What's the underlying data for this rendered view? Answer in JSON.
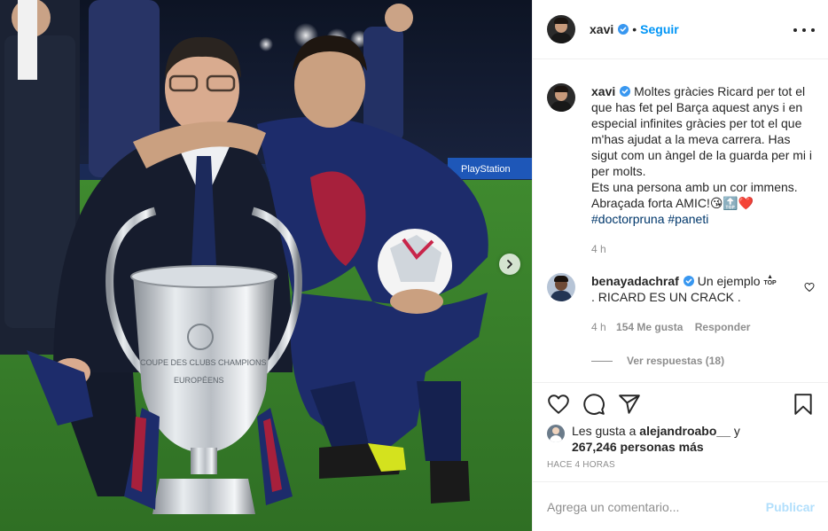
{
  "post": {
    "username": "xavi",
    "follow_label": "Seguir",
    "header_separator": "•",
    "caption": {
      "username": "xavi",
      "text": "Moltes gràcies Ricard per tot el que has fet pel Barça aquest anys i en especial infinites gràcies per tot el que m'has ajudat a la meva carrera. Has sigut com un àngel de la guarda per mi i per molts.\nEts una persona amb un cor immens. Abraçada forta AMIC!😘🔝❤️",
      "tags": "#doctorpruna #paneti",
      "time": "4 h"
    },
    "comments": [
      {
        "username": "benayadachraf",
        "text_before": "Un ejemplo",
        "badge": "TOP",
        "text_after": ". RICARD ES UN CRACK .",
        "time": "4 h",
        "likes": "154 Me gusta",
        "reply_label": "Responder"
      }
    ],
    "view_replies": "Ver respuestas (18)",
    "likes": {
      "prefix": "Les gusta a",
      "liker": "alejandroabo__",
      "connector": "y",
      "others": "267,246 personas más"
    },
    "time_ago": "HACE 4 HORAS",
    "add_comment_placeholder": "Agrega un comentario...",
    "publish_label": "Publicar"
  },
  "photo": {
    "trophy_text_top": "COUPE DES CLUBS CHAMPIONS",
    "trophy_text_bottom": "EUROPÉENS",
    "banner_text": "PlayStation"
  },
  "colors": {
    "accent": "#0095f6",
    "publish_disabled": "#b2dffc",
    "muted": "#8e8e8e",
    "barca_blue": "#1d2c6b",
    "barca_red": "#a7203c"
  },
  "icons": [
    "verified-icon",
    "more-options-icon",
    "heart-icon",
    "comment-icon",
    "share-icon",
    "bookmark-icon",
    "chevron-right-icon"
  ]
}
